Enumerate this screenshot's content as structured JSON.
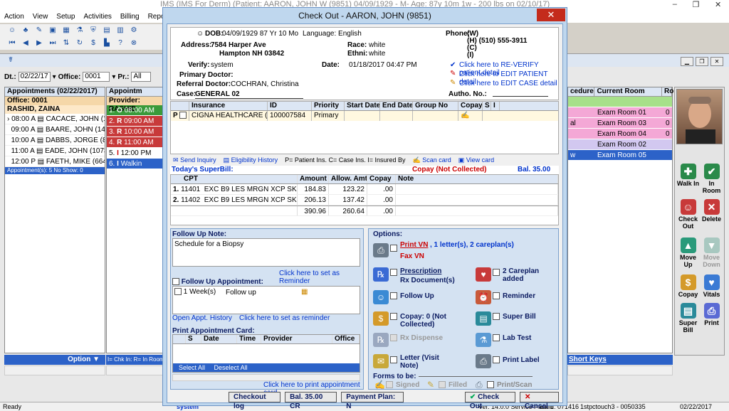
{
  "app": {
    "title": "IMS (IMS  For Derm)    (Patient: AARON, JOHN W (9851) 04/09/1929 - M- Age: 87y 10m 1w - 200 lbs on 02/10/17)",
    "window_controls": [
      "–",
      "❐",
      "✕"
    ],
    "menu": [
      "Action",
      "View",
      "Setup",
      "Activities",
      "Billing",
      "Reports"
    ]
  },
  "filter": {
    "dt_label": "Dt.:",
    "dt_value": "02/22/17",
    "office_label": "Office:",
    "office_value": "0001",
    "pr_label": "Pr.:",
    "pr_value": "All"
  },
  "appointments": {
    "header": "Appointments (02/22/2017)",
    "office": "Office: 0001",
    "provider": "RASHID, ZAINA",
    "rows": [
      {
        "time": "08:00 A",
        "name": "CACACE, JOHN (120"
      },
      {
        "time": "09:00 A",
        "name": "BAARE, JOHN (1403"
      },
      {
        "time": "10:00 A",
        "name": "DABBS, JORGE (8570)"
      },
      {
        "time": "11:00 A",
        "name": "EADE, JOHN (10731)"
      },
      {
        "time": "12:00 P",
        "name": "FAETH, MIKE (6648)"
      }
    ],
    "footer": "Appointment(s): 5   No Show: 0",
    "option_label": "Option"
  },
  "provider_col": {
    "header": "Appointm",
    "provider": "Provider: RASHID",
    "rows": [
      {
        "num": "1.",
        "code": "O",
        "time": "08:00 AM"
      },
      {
        "num": "2.",
        "code": "R",
        "time": "09:00 AM"
      },
      {
        "num": "3.",
        "code": "R",
        "time": "10:00 AM"
      },
      {
        "num": "4.",
        "code": "R",
        "time": "11:00 AM"
      },
      {
        "num": "5.",
        "code": "I",
        "time": "12:00 PM"
      },
      {
        "num": "6.",
        "code": "I",
        "time": "Walkin"
      }
    ],
    "legend": "I= Chk In: R= In Room"
  },
  "right_grid": {
    "headers": [
      "cedure",
      "Current Room",
      "Ro"
    ],
    "rows": [
      {
        "proc": "",
        "room": "",
        "ro": ""
      },
      {
        "proc": "",
        "room": "Exam Room 01",
        "ro": "0"
      },
      {
        "proc": "al",
        "room": "Exam Room 03",
        "ro": "0"
      },
      {
        "proc": "",
        "room": "Exam Room 04",
        "ro": "0"
      },
      {
        "proc": "",
        "room": "Exam Room 02",
        "ro": ""
      },
      {
        "proc": "w",
        "room": "Exam Room 05",
        "ro": ""
      }
    ],
    "short_keys": "Short Keys"
  },
  "sidebar": {
    "walkin": "Walk In",
    "inroom": "In Room",
    "checkout": "Check Out",
    "delete": "Delete",
    "moveup": "Move Up",
    "movedown": "Move Down",
    "copay": "Copay",
    "vitals": "Vitals",
    "superbill": "Super Bill",
    "print": "Print"
  },
  "status": {
    "ready": "Ready",
    "system": "system",
    "version": "Ver. 14.0.0 Service Pack 1",
    "build": "Build: 071416",
    "station": "1stpctouch3 - 0050335",
    "date": "02/22/2017"
  },
  "dialog": {
    "title": "Check Out - AARON, JOHN  (9851)",
    "close": "✕",
    "patient": {
      "dob_label": "DOB:",
      "dob": "04/09/1929 87 Yr 10 Mo",
      "language": "Language: English",
      "phone_label": "Phone:",
      "phone_w": "(W)",
      "phone_h": "(H)  (510) 555-3911",
      "phone_c": "(C)",
      "phone_i": "(I)",
      "address_label": "Address:",
      "address1": "7584 Harper Ave",
      "address2": "Hampton  NH  03842",
      "race_label": "Race:",
      "race": "white",
      "ethni_label": "Ethni:",
      "ethni": "white",
      "verify_label": "Verify:",
      "verify": "system",
      "date_label": "Date:",
      "date": "01/18/2017 04:47 PM",
      "reverify": "Click here to RE-VERIFY patient detail",
      "edit_patient": "Click here to EDIT PATIENT detail",
      "edit_case": "Click here to EDIT CASE detail",
      "primary_doctor_label": "Primary Doctor:",
      "referral_label": "Referral Doctor:",
      "referral": "COCHRAN, Christina",
      "case_label": "Case:",
      "case": "GENERAL 02",
      "autho_label": "Autho. No.:"
    },
    "insurance": {
      "headers": [
        "Insurance",
        "ID",
        "Priority",
        "Start Date",
        "End Date",
        "Group No",
        "Copay",
        "S",
        "I"
      ],
      "row": {
        "type": "P",
        "name": "CIGNA HEALTHCARE  (91",
        "id": "100007584",
        "priority": "Primary"
      },
      "send_inquiry": "Send Inquiry",
      "eligibility": "Eligibility History",
      "legend": "P= Patient Ins. C= Case Ins. I= Insured By",
      "scan": "Scan card",
      "view": "View card"
    },
    "superbill": {
      "label": "Today's SuperBill:",
      "copay_status": "Copay (Not Collected)",
      "balance": "Bal. 35.00 CR",
      "headers": [
        "CPT",
        "Amount",
        "Allow. Amt",
        "Copay",
        "Note"
      ],
      "rows": [
        {
          "n": "1.",
          "cpt": "11401",
          "desc": "EXC B9 LES MRGN XCP SK TG",
          "amount": "184.83",
          "allow": "123.22",
          "copay": ".00"
        },
        {
          "n": "2.",
          "cpt": "11402",
          "desc": "EXC B9 LES MRGN XCP SK TG",
          "amount": "206.13",
          "allow": "137.42",
          "copay": ".00"
        }
      ],
      "totals": {
        "amount": "390.96",
        "allow": "260.64",
        "copay": ".00"
      }
    },
    "followup": {
      "note_label": "Follow Up Note:",
      "note": "Schedule for a Biopsy",
      "reminder_link": "Click here to set as Reminder",
      "appt_label": "Follow Up Appointment:",
      "appt_qty": "1  Week(s)",
      "appt_type": "Follow up",
      "open_history": "Open Appt. History",
      "set_reminder": "Click here to set as reminder",
      "card_label": "Print Appointment Card:",
      "card_headers": [
        "S",
        "Date",
        "Time",
        "Provider",
        "Office"
      ],
      "select_all": "Select All",
      "deselect_all": "Deselect All",
      "print_card": "Click here to print appointment card"
    },
    "options": {
      "label": "Options:",
      "print_vn": "Print VN",
      "print_vn_detail": ", 1 letter(s), 2 careplan(s)",
      "fax_vn": "Fax VN",
      "prescription": "Prescription",
      "rx_docs": "Rx Document(s)",
      "careplan": "2 Careplan added",
      "followup": "Follow Up",
      "reminder": "Reminder",
      "copay": "Copay: 0 (Not Collected)",
      "superbill": "Super Bill",
      "rx_dispense": "Rx Dispense",
      "lab_test": "Lab Test",
      "letter": "Letter (Visit Note)",
      "print_label": "Print Label",
      "forms_label": "Forms to be:",
      "signed": "Signed",
      "filled": "Filled",
      "printscan": "Print/Scan"
    },
    "buttons": {
      "checkout_log": "Checkout log",
      "balance": "Bal.  35.00 CR",
      "payment_plan": "Payment Plan: N",
      "check_out": "Check Out",
      "cancel": "Cancel"
    }
  }
}
